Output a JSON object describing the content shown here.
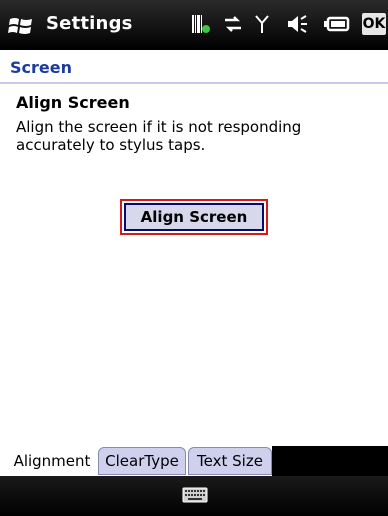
{
  "topbar": {
    "title": "Settings",
    "ok_label": "OK",
    "icons": [
      "start-flag-icon",
      "barcode-scanner-icon",
      "sync-icon",
      "signal-icon",
      "volume-icon",
      "battery-icon"
    ]
  },
  "section": {
    "title": "Screen"
  },
  "content": {
    "heading": "Align Screen",
    "description": "Align the screen if it is not responding accurately to stylus taps.",
    "button_label": "Align Screen"
  },
  "tabs": [
    {
      "label": "Alignment",
      "active": true
    },
    {
      "label": "ClearType",
      "active": false
    },
    {
      "label": "Text Size",
      "active": false
    }
  ],
  "bottombar": {
    "icon": "keyboard-icon"
  },
  "colors": {
    "section_title": "#1c3c9c",
    "button_highlight": "#d21c1c",
    "button_fill": "#d8d8ec",
    "tab_inactive": "#cfcfee"
  }
}
